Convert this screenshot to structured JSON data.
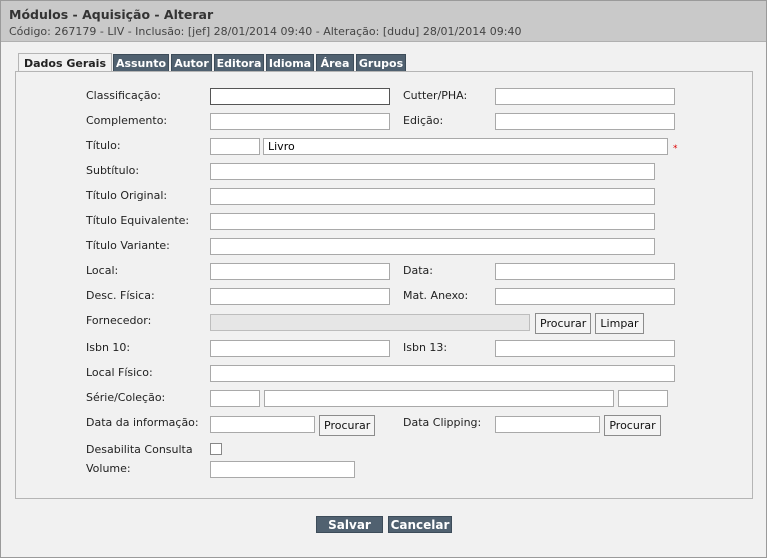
{
  "header": {
    "title": "Módulos - Aquisição - Alterar",
    "subtitle": "Código: 267179 - LIV - Inclusão: [jef] 28/01/2014 09:40 - Alteração: [dudu] 28/01/2014 09:40"
  },
  "tabs": [
    "Dados Gerais",
    "Assunto",
    "Autor",
    "Editora",
    "Idioma",
    "Área",
    "Grupos"
  ],
  "form": {
    "classificacao": "Classificação:",
    "cutter": "Cutter/PHA:",
    "complemento": "Complemento:",
    "edicao": "Edição:",
    "titulo": "Título:",
    "titulo_value": "Livro",
    "required_mark": "*",
    "subtitulo": "Subtítulo:",
    "titulo_original": "Título Original:",
    "titulo_equivalente": "Título Equivalente:",
    "titulo_variante": "Título Variante:",
    "local": "Local:",
    "data": "Data:",
    "desc_fisica": "Desc. Física:",
    "mat_anexo": "Mat. Anexo:",
    "fornecedor": "Fornecedor:",
    "procurar": "Procurar",
    "limpar": "Limpar",
    "isbn10": "Isbn 10:",
    "isbn13": "Isbn 13:",
    "local_fisico": "Local Físico:",
    "serie": "Série/Coleção:",
    "data_informacao": "Data da informação:",
    "data_clipping": "Data Clipping:",
    "desabilita": "Desabilita Consulta",
    "volume": "Volume:"
  },
  "actions": {
    "save": "Salvar",
    "cancel": "Cancelar"
  }
}
